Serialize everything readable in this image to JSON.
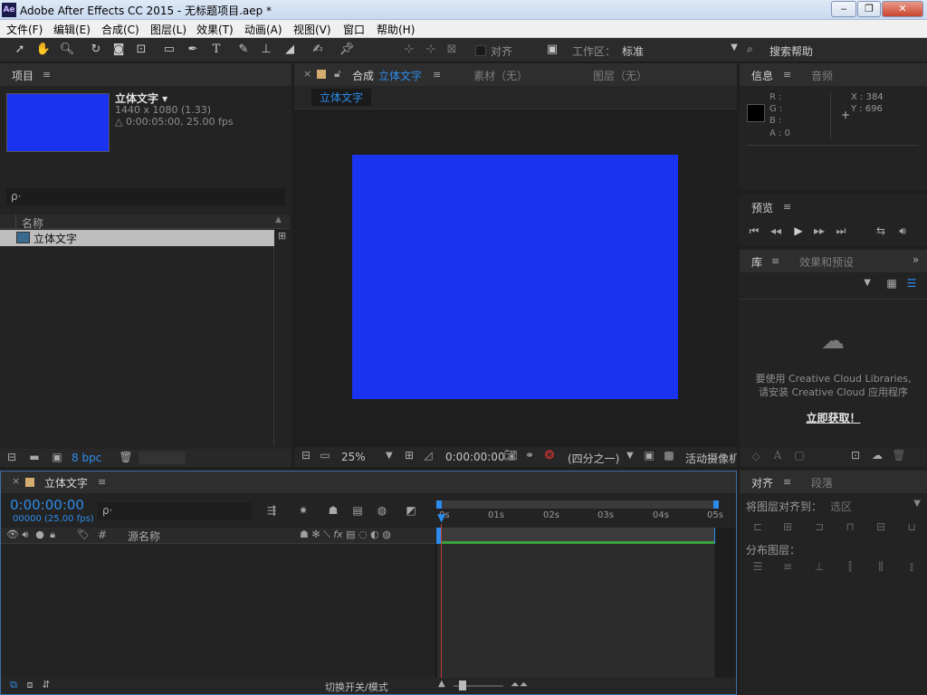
{
  "app": {
    "title": "Adobe After Effects CC 2015 - 无标题项目.aep *",
    "logo": "Ae"
  },
  "menu": [
    "文件(F)",
    "编辑(E)",
    "合成(C)",
    "图层(L)",
    "效果(T)",
    "动画(A)",
    "视图(V)",
    "窗口",
    "帮助(H)"
  ],
  "toolbar": {
    "align_label": "对齐",
    "workspace_label": "工作区：",
    "workspace_value": "标准",
    "search_help": "搜索帮助"
  },
  "project": {
    "tab": "项目",
    "comp_name": "立体文字 ▾",
    "comp_size": "1440 x 1080 (1.33)",
    "comp_duration": "△ 0:00:05:00, 25.00 fps",
    "search_placeholder": "ρ·",
    "col_name": "名称",
    "item_name": "立体文字",
    "bpc": "8 bpc",
    "thumb_color": "#1a33ee"
  },
  "composition": {
    "tab_prefix": "合成",
    "tab_name": "立体文字",
    "footage_tab": "素材（无）",
    "layer_tab": "图层（无）",
    "breadcrumb": "立体文字",
    "comp_color": "#1a33ee",
    "zoom": "25%",
    "timecode": "0:00:00:00",
    "resolution": "(四分之一)",
    "camera": "活动摄像机"
  },
  "info": {
    "tab": "信息",
    "audio_tab": "音频",
    "r": "R :",
    "g": "G :",
    "b": "B :",
    "a": "A : 0",
    "x": "X : 384",
    "y": "Y : 696"
  },
  "preview": {
    "tab": "预览"
  },
  "library": {
    "tab": "库",
    "effects_tab": "效果和预设",
    "message1": "要使用 Creative Cloud Libraries,",
    "message2": "请安装 Creative Cloud 应用程序",
    "link": "立即获取！"
  },
  "timeline": {
    "tab": "立体文字",
    "timecode": "0:00:00:00",
    "frame_info": "00000 (25.00 fps)",
    "search_placeholder": "ρ·",
    "col_hash": "#",
    "col_source": "源名称",
    "ruler": [
      "0s",
      "01s",
      "02s",
      "03s",
      "04s",
      "05s"
    ],
    "footer_toggle": "切换开关/模式"
  },
  "align": {
    "tab": "对齐",
    "paragraph_tab": "段落",
    "align_to_label": "将图层对齐到：",
    "align_to_value": "选区",
    "distribute_label": "分布图层："
  },
  "colors": {
    "accent": "#2d8ceb",
    "work_area": "#3da33d",
    "playhead": "#c33a3a"
  }
}
